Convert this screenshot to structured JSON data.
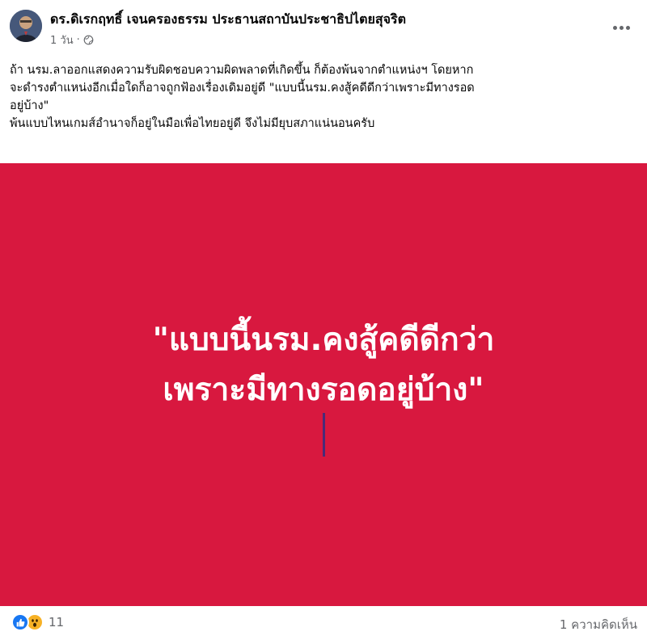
{
  "post": {
    "author": "ดร.ดิเรกฤทธิ์ เจนครองธรรม ประธานสถาบันประชาธิปไตยสุจริต",
    "timestamp": "1 วัน",
    "separator": "·",
    "privacy_icon": "globe-icon",
    "more_icon": "more-options-icon",
    "text_lines": [
      "ถ้า นรม.ลาออกแสดงความรับผิดชอบความผิดพลาดที่เกิดขึ้น ก็ต้องพ้นจากตำแหน่งฯ โดยหาก",
      "จะดำรงตำแหน่งอีกเมื่อใดก็อาจถูกฟ้องเรื่องเดิมอยู่ดี \"แบบนี้นรม.คงสู้คดีดีกว่าเพราะมีทางรอด",
      "อยู่บ้าง\"",
      "พ้นแบบไหนเกมส์อำนาจก็อยู่ในมือเพื่อไทยอยู่ดี จึงไม่มียุบสภาแน่นอนครับ"
    ]
  },
  "image": {
    "background_color": "#d8183f",
    "quote_lines": [
      "\"แบบนี้นรม.คงสู้คดีดีกว่า",
      "เพราะมีทางรอดอยู่บ้าง\""
    ]
  },
  "footer": {
    "reaction_icons": [
      "like-icon",
      "wow-icon"
    ],
    "reaction_count": "11",
    "comment_count": "1 ความคิดเห็น"
  },
  "colors": {
    "accent": "#1877f2",
    "secondary_text": "#65676b",
    "image_bg": "#d8183f"
  }
}
